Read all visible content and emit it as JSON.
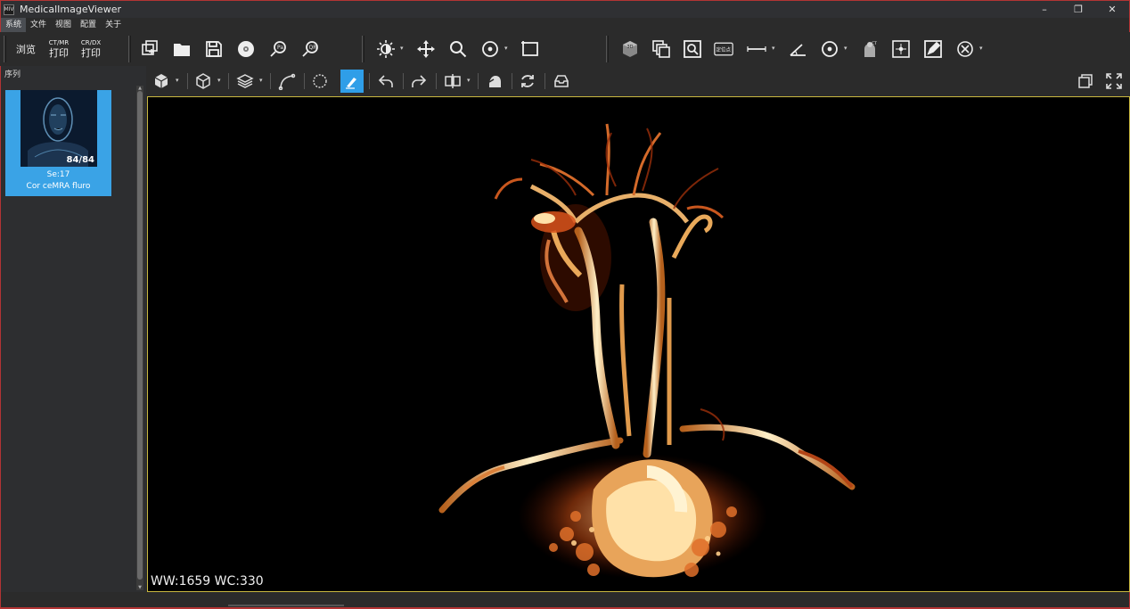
{
  "window": {
    "title": "MedicalImageViewer",
    "icon_text": "MIV"
  },
  "window_controls": {
    "minimize": "–",
    "restore": "❐",
    "close": "✕"
  },
  "menu": [
    "系统",
    "文件",
    "视图",
    "配置",
    "关于"
  ],
  "toolbar1": {
    "browse_label": "浏览",
    "ctmr_small": "CT/MR",
    "ctmr_big": "打印",
    "crdx_small": "CR/DX",
    "crdx_big": "打印",
    "locate_label": "定位点"
  },
  "series_panel": {
    "header": "序列",
    "thumbnail": {
      "count": "84/84",
      "series": "Se:17",
      "description": "Cor ceMRA fluro"
    }
  },
  "viewport": {
    "overlay": "WW:1659 WC:330"
  }
}
